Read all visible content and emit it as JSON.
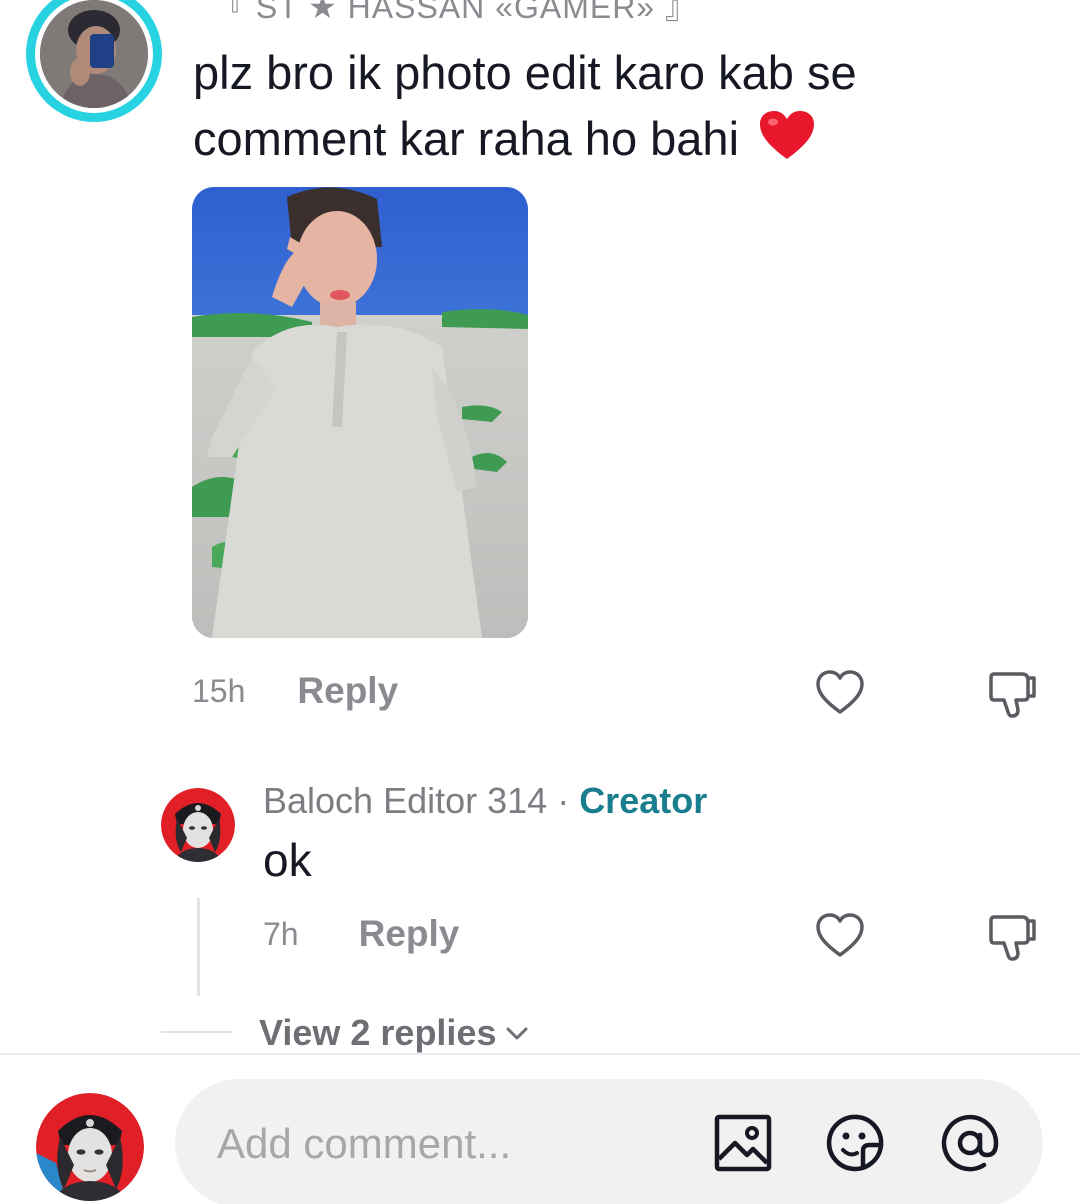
{
  "top_comment": {
    "username": "『 ST ★ HASSAN «GAMER» 』",
    "text": "plz bro ik photo edit karo kab se comment kar raha ho bahi",
    "emoji": "❤",
    "time": "15h",
    "reply_label": "Reply"
  },
  "reply_comment": {
    "author": "Baloch Editor 314",
    "separator": " · ",
    "badge": "Creator",
    "text": "ok",
    "time": "7h",
    "reply_label": "Reply"
  },
  "thread": {
    "view_replies_label": "View 2 replies"
  },
  "composer": {
    "placeholder": "Add comment..."
  },
  "icons": {
    "like": "heart-outline-icon",
    "dislike": "thumbs-down-icon",
    "image": "image-icon",
    "emoji": "emoji-icon",
    "mention": "at-icon"
  },
  "colors": {
    "creator_accent": "#1b7e8f",
    "avatar_ring": "#27d3e0",
    "emoji_heart": "#e8172c",
    "muted_text": "#8a8b91"
  }
}
